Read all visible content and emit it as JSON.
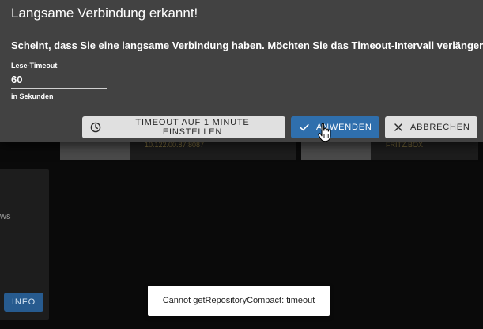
{
  "background": {
    "left_card_text": "ws",
    "info_button_label": "INFO",
    "tile1_text": "10.122.00.87:8087",
    "tile2_text": "FRITZ.BOX"
  },
  "dialog": {
    "title": "Langsame Verbindung erkannt!",
    "message": "Scheint, dass Sie eine langsame Verbindung haben. Möchten Sie das Timeout-Intervall verlängern?",
    "field": {
      "label": "Lese-Timeout",
      "value": "60",
      "helper": "in Sekunden"
    },
    "buttons": {
      "set_timeout": "TIMEOUT AUF 1 MINUTE EINSTELLEN",
      "apply": "ANWENDEN",
      "cancel": "ABBRECHEN"
    }
  },
  "snackbar": {
    "message": "Cannot getRepositoryCompact: timeout"
  },
  "colors": {
    "dialog_bg": "#424242",
    "primary": "#2f6fad",
    "light_button": "#e0e0e0",
    "page_bg": "#0a0a0a"
  },
  "icons": {
    "set_timeout": "clock-icon",
    "apply": "check-icon",
    "cancel": "close-icon",
    "pointer": "hand-pointer-cursor"
  }
}
